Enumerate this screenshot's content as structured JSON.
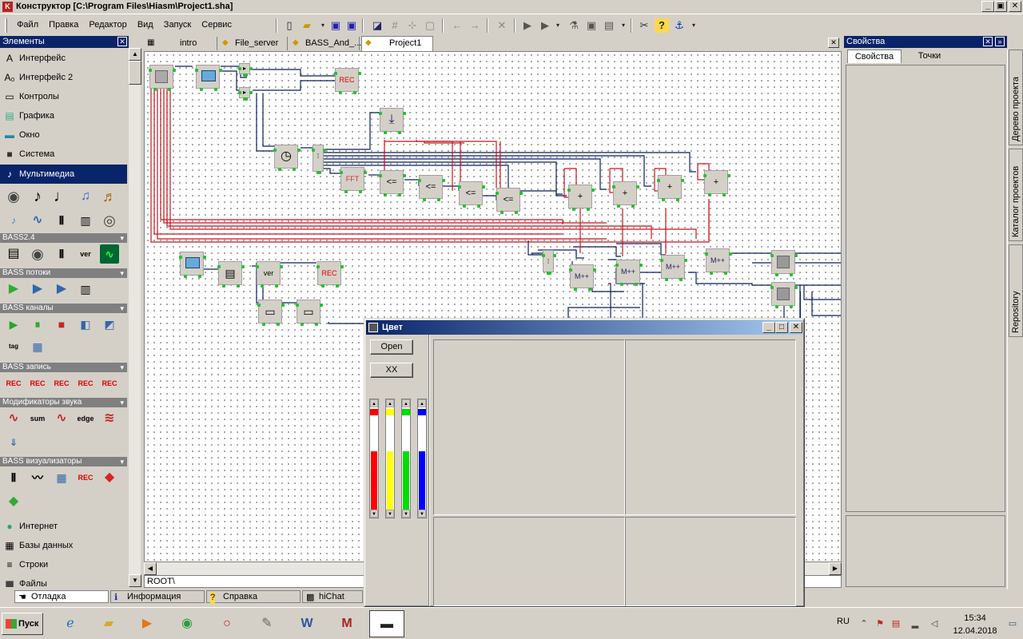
{
  "window": {
    "title": "Конструктор [C:\\Program Files\\Hiasm\\Project1.sha]",
    "minimize": "_",
    "maximize": "▣",
    "close": "✕"
  },
  "menu": [
    "Файл",
    "Правка",
    "Редактор",
    "Вид",
    "Запуск",
    "Сервис",
    "Помощь"
  ],
  "palette": {
    "title": "Элементы",
    "categories_top": [
      {
        "label": "Интерфейс",
        "icon": "A"
      },
      {
        "label": "Интерфейс 2",
        "icon": "A₀"
      },
      {
        "label": "Контролы",
        "icon": "▭"
      },
      {
        "label": "Графика",
        "icon": "▤"
      },
      {
        "label": "Окно",
        "icon": "▬"
      },
      {
        "label": "Система",
        "icon": "■"
      },
      {
        "label": "Мультимедиа",
        "icon": "♪"
      }
    ],
    "groups": [
      {
        "label": "BASS2.4"
      },
      {
        "label": "BASS потоки"
      },
      {
        "label": "BASS каналы"
      },
      {
        "label": "BASS запись"
      },
      {
        "label": "Модификаторы звука"
      },
      {
        "label": "BASS визуализаторы"
      }
    ],
    "icon_labels": {
      "ver": "ver",
      "tag": "tag",
      "sum": "sum",
      "edge": "edge",
      "rec": "REC"
    },
    "categories_bottom": [
      {
        "label": "Интернет",
        "icon": "●"
      },
      {
        "label": "Базы данных",
        "icon": "▦"
      },
      {
        "label": "Строки",
        "icon": "≡"
      },
      {
        "label": "Файлы",
        "icon": "▆"
      }
    ]
  },
  "editor": {
    "tabs": [
      "intro",
      "File_server",
      "BASS_And_...",
      "Project1"
    ],
    "active_tab": "Project1",
    "path": "ROOT\\",
    "component_labels": {
      "le": "<=",
      "plus": "+",
      "rec": "REC",
      "ver": "ver",
      "fft": "FFT",
      "m": "M++"
    }
  },
  "properties": {
    "title": "Свойства",
    "tabs": [
      "Свойства",
      "Точки"
    ]
  },
  "side_tabs": [
    "Дерево проекта",
    "Каталог проектов",
    "Repository"
  ],
  "bottom_tabs": [
    "Отладка",
    "Информация",
    "Справка",
    "hiChat"
  ],
  "dialog": {
    "title": "Цвет",
    "open_button": "Open",
    "xx_button": "XX",
    "sliders": [
      {
        "color": "#ff0000",
        "level": 0.58
      },
      {
        "color": "#ffff00",
        "level": 0.58
      },
      {
        "color": "#00dd00",
        "level": 0.58
      },
      {
        "color": "#0000ff",
        "level": 0.58
      }
    ]
  },
  "taskbar": {
    "start": "Пуск",
    "lang": "RU",
    "time": "15:34",
    "date": "12.04.2018"
  }
}
